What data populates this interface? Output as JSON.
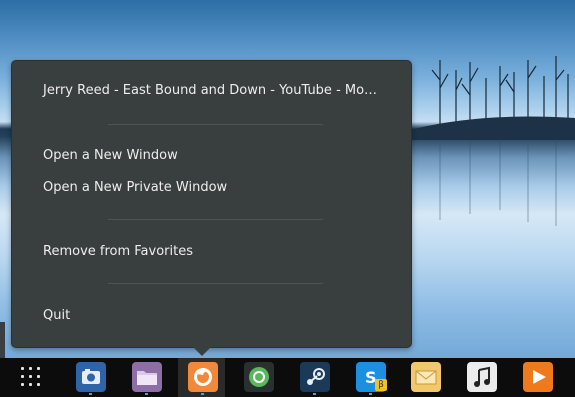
{
  "menu": {
    "window_title": "Jerry Reed - East Bound and Down - YouTube - Mo…",
    "open_new_window": "Open a New Window",
    "open_new_private_window": "Open a New Private Window",
    "remove_from_favorites": "Remove from Favorites",
    "quit": "Quit"
  },
  "dock": {
    "items": [
      {
        "name": "show-applications",
        "icon": "grid-icon"
      },
      {
        "name": "screenshot",
        "icon": "camera-icon"
      },
      {
        "name": "files",
        "icon": "folder-icon"
      },
      {
        "name": "firefox",
        "icon": "firefox-icon",
        "active": true
      },
      {
        "name": "chrome",
        "icon": "chrome-icon"
      },
      {
        "name": "steam",
        "icon": "steam-icon"
      },
      {
        "name": "skype",
        "icon": "skype-icon",
        "badge": "β"
      },
      {
        "name": "mail",
        "icon": "mail-icon"
      },
      {
        "name": "music",
        "icon": "music-icon"
      },
      {
        "name": "media-player",
        "icon": "play-icon"
      }
    ]
  },
  "colors": {
    "menu_bg": "#393f3f",
    "dock_bg": "#0c0c0c",
    "running_indicator": "#4aa3e8"
  }
}
